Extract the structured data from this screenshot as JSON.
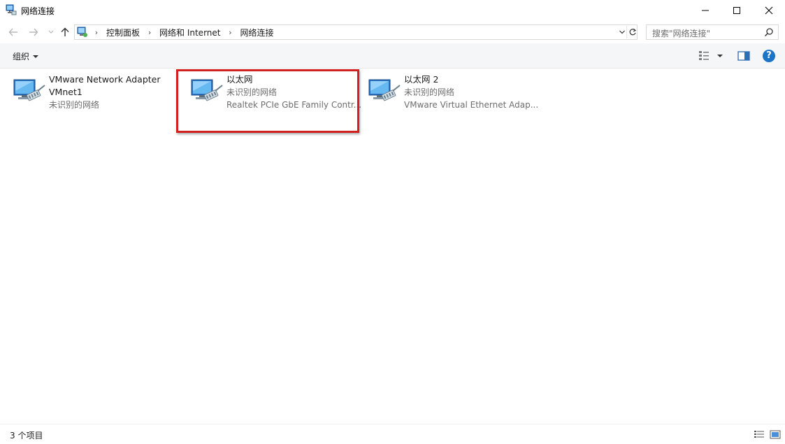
{
  "window": {
    "title": "网络连接",
    "icon": "network-connections-icon"
  },
  "nav": {
    "breadcrumbs": [
      "控制面板",
      "网络和 Internet",
      "网络连接"
    ]
  },
  "search": {
    "placeholder": "搜索\"网络连接\""
  },
  "toolbar": {
    "organize_label": "组织"
  },
  "connections": [
    {
      "name_line1": "VMware Network Adapter",
      "name_line2": "VMnet1",
      "status": "未识别的网络",
      "icon": "network-adapter-icon"
    },
    {
      "name": "以太网",
      "status": "未识别的网络",
      "device": "Realtek PCIe GbE Family Contr...",
      "icon": "network-adapter-icon",
      "highlighted": true
    },
    {
      "name": "以太网 2",
      "status": "未识别的网络",
      "device": "VMware Virtual Ethernet Adap...",
      "icon": "network-adapter-icon"
    }
  ],
  "status_bar": {
    "item_count": "3 个项目"
  },
  "colors": {
    "highlight_border": "#d21f1f",
    "help_blue": "#1c74c9",
    "toolbar_bg": "#f5f6f7"
  }
}
